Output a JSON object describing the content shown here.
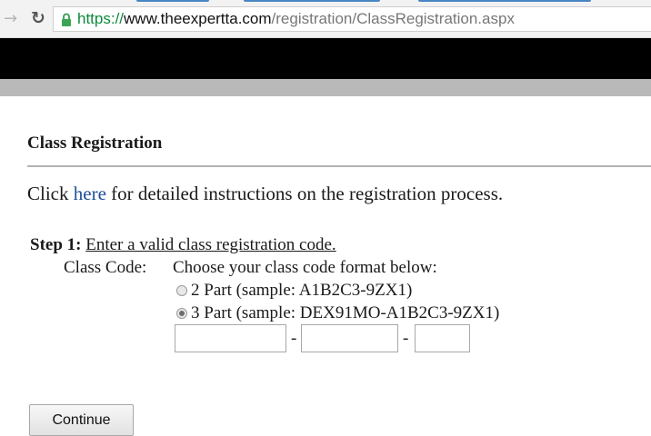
{
  "browser": {
    "url_scheme": "https://",
    "url_host": "www.theexpertta.com",
    "url_path": "/registration/ClassRegistration.aspx"
  },
  "page": {
    "title": "Class Registration",
    "instructions_prefix": "Click ",
    "instructions_link": "here",
    "instructions_suffix": " for detailed instructions on the registration process."
  },
  "step1": {
    "label": "Step 1:",
    "instruction": "Enter a valid class registration code."
  },
  "class_code": {
    "label": "Class Code:",
    "prompt": "Choose your class code format below:",
    "options": [
      {
        "label": "2 Part (sample: A1B2C3-9ZX1)",
        "selected": false
      },
      {
        "label": "3 Part (sample: DEX91MO-A1B2C3-9ZX1)",
        "selected": true
      }
    ],
    "fields": [
      {
        "value": ""
      },
      {
        "value": ""
      },
      {
        "value": ""
      }
    ],
    "separator": "-"
  },
  "actions": {
    "continue_label": "Continue"
  },
  "icons": {
    "forward": "forward-arrow-icon",
    "reload": "reload-icon",
    "lock": "lock-icon"
  },
  "colors": {
    "link": "#1f4e99",
    "secure_scheme": "#0b8a3a",
    "header_bar": "#000000",
    "nav_bar": "#b9b9b9"
  }
}
